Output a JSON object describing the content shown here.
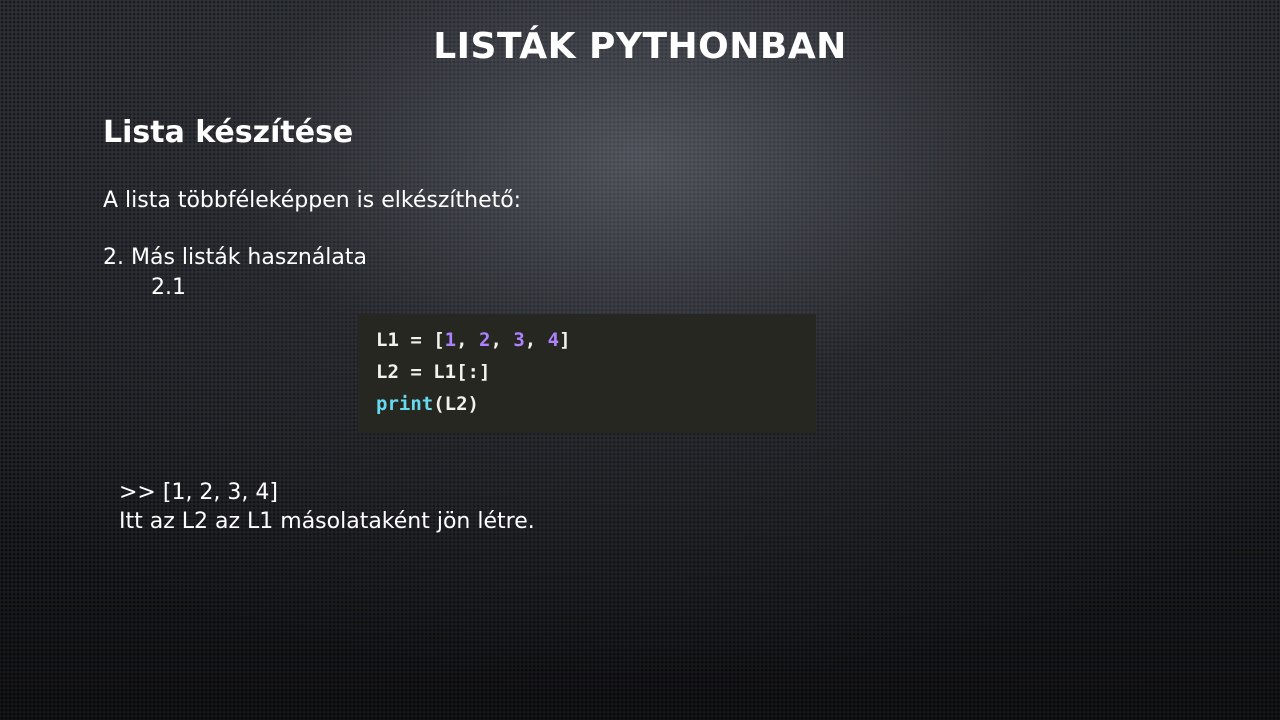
{
  "slide": {
    "title": "LISTÁK PYTHONBAN",
    "section_title": "Lista készítése",
    "intro": "A lista többféleképpen is elkészíthető:",
    "list_item": "2. Más listák használata",
    "sub_item": "2.1"
  },
  "code": {
    "line1": {
      "lhs": "L1 = [",
      "n1": "1",
      "sep1": ", ",
      "n2": "2",
      "sep2": ", ",
      "n3": "3",
      "sep3": ", ",
      "n4": "4",
      "close": "]"
    },
    "line2": "L2 = L1[:]",
    "line3": {
      "fn": "print",
      "args": "(L2)"
    }
  },
  "output": {
    "result": ">> [1, 2, 3, 4]",
    "note": "Itt az L2 az L1 másolataként jön létre."
  },
  "colors": {
    "code_background": "#262720",
    "code_text": "#f3f3ee",
    "code_number": "#ae81ff",
    "code_function": "#66d9ef",
    "slide_text": "#ffffff"
  }
}
